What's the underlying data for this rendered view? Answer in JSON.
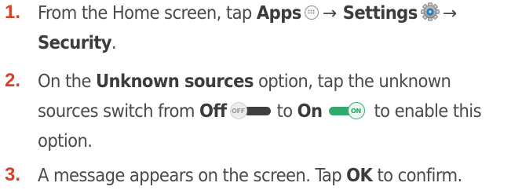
{
  "steps": [
    {
      "number": "1.",
      "text_1": "From the Home screen, tap",
      "apps_label": "Apps",
      "apps_icon": "apps-grid-icon",
      "arrow_1": "→",
      "settings_label": "Settings",
      "settings_icon": "gear-icon",
      "arrow_2": "→",
      "security_label": "Security",
      "text_end": "."
    },
    {
      "number": "2.",
      "text_1": "On the",
      "unknown_sources_label": "Unknown sources",
      "text_2": "option, tap the unknown",
      "text_3": "sources switch from",
      "off_label": "Off",
      "off_switch_text": "OFF",
      "text_4": "to",
      "on_label": "On",
      "on_switch_text": "ON",
      "text_5": "to enable this",
      "text_6": "option."
    },
    {
      "number": "3.",
      "text_1": "A message appears on the screen. Tap",
      "ok_label": "OK",
      "text_2": "to confirm."
    }
  ],
  "colors": {
    "step_number": "#dc3f26",
    "body_text": "#4a4a4a",
    "switch_on": "#34a86e",
    "switch_off_track": "#3f3f3f"
  }
}
